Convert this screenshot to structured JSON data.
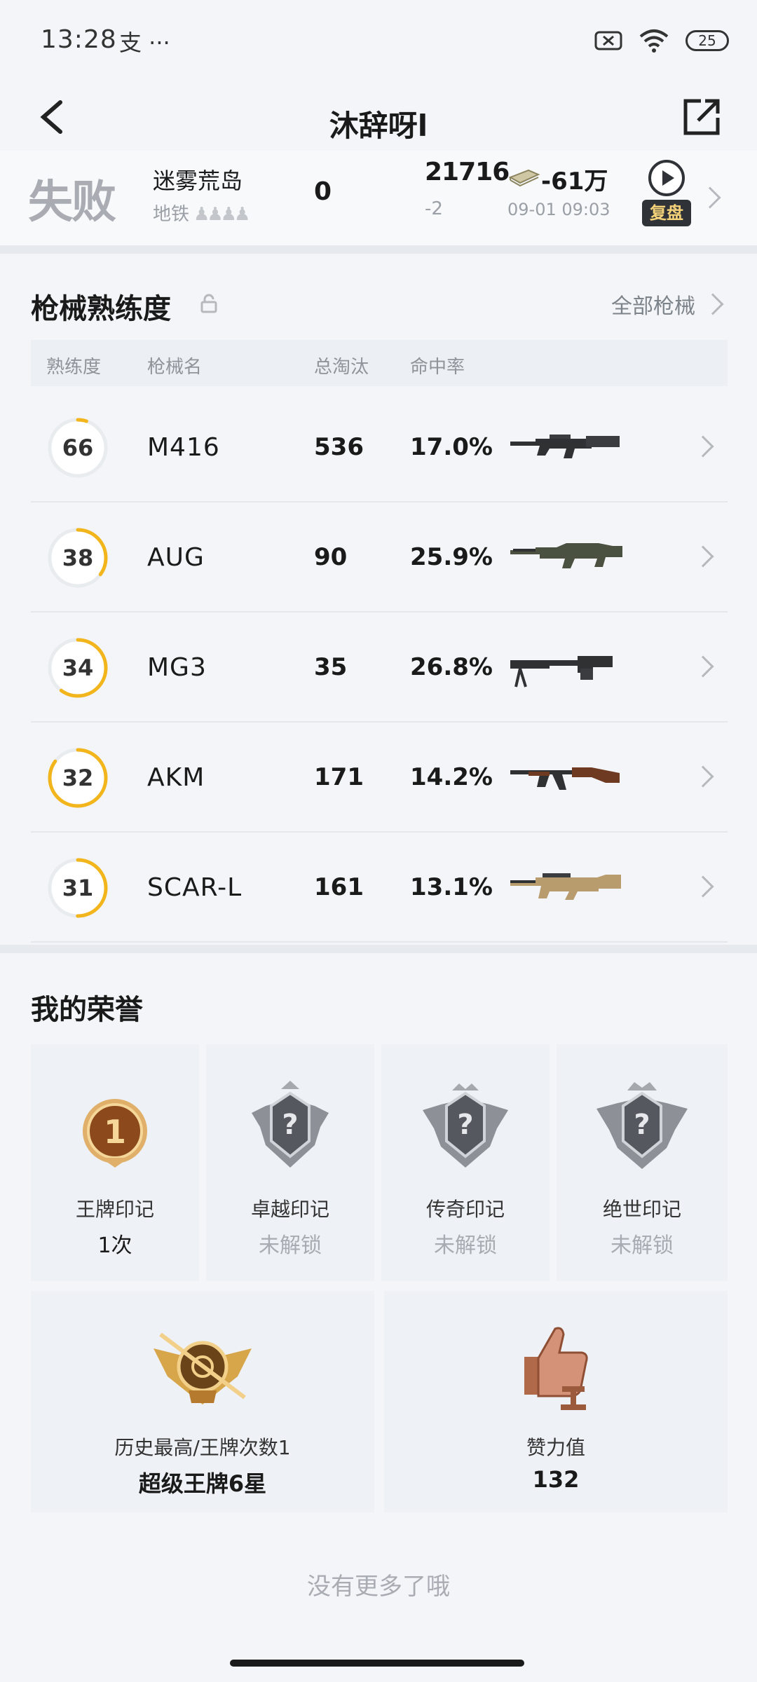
{
  "status": {
    "time": "13:28",
    "extra": "支 ···",
    "battery": "25"
  },
  "nav": {
    "title": "沐辞呀l"
  },
  "match": {
    "result": "失败",
    "map": "迷雾荒岛",
    "mode": "地铁",
    "kills": "0",
    "rank_points": "21716",
    "rank_delta": "-2",
    "money": "-61万",
    "datetime": "09-01 09:03",
    "replay_label": "复盘"
  },
  "weapons": {
    "title": "枪械熟练度",
    "all_label": "全部枪械",
    "headers": {
      "mastery": "熟练度",
      "name": "枪械名",
      "kills": "总淘汰",
      "accuracy": "命中率"
    },
    "rows": [
      {
        "level": "66",
        "name": "M416",
        "kills": "536",
        "accuracy": "17.0%",
        "progress": 0.05,
        "icon": "m416-rifle-icon"
      },
      {
        "level": "38",
        "name": "AUG",
        "kills": "90",
        "accuracy": "25.9%",
        "progress": 0.35,
        "icon": "aug-rifle-icon"
      },
      {
        "level": "34",
        "name": "MG3",
        "kills": "35",
        "accuracy": "26.8%",
        "progress": 0.6,
        "icon": "mg3-machinegun-icon"
      },
      {
        "level": "32",
        "name": "AKM",
        "kills": "171",
        "accuracy": "14.2%",
        "progress": 0.85,
        "icon": "akm-rifle-icon"
      },
      {
        "level": "31",
        "name": "SCAR-L",
        "kills": "161",
        "accuracy": "13.1%",
        "progress": 0.5,
        "icon": "scar-l-rifle-icon"
      }
    ]
  },
  "honors": {
    "title": "我的荣誉",
    "marks": [
      {
        "name": "王牌印记",
        "value": "1次",
        "locked": false
      },
      {
        "name": "卓越印记",
        "value": "未解锁",
        "locked": true
      },
      {
        "name": "传奇印记",
        "value": "未解锁",
        "locked": true
      },
      {
        "name": "绝世印记",
        "value": "未解锁",
        "locked": true
      }
    ],
    "highest": {
      "label": "历史最高/王牌次数1",
      "value": "超级王牌6星"
    },
    "likes": {
      "label": "赞力值",
      "value": "132"
    }
  },
  "footer": {
    "no_more": "没有更多了哦"
  },
  "colors": {
    "accent": "#f2b51c",
    "background": "#f3f5f8",
    "card": "#eef1f5"
  }
}
